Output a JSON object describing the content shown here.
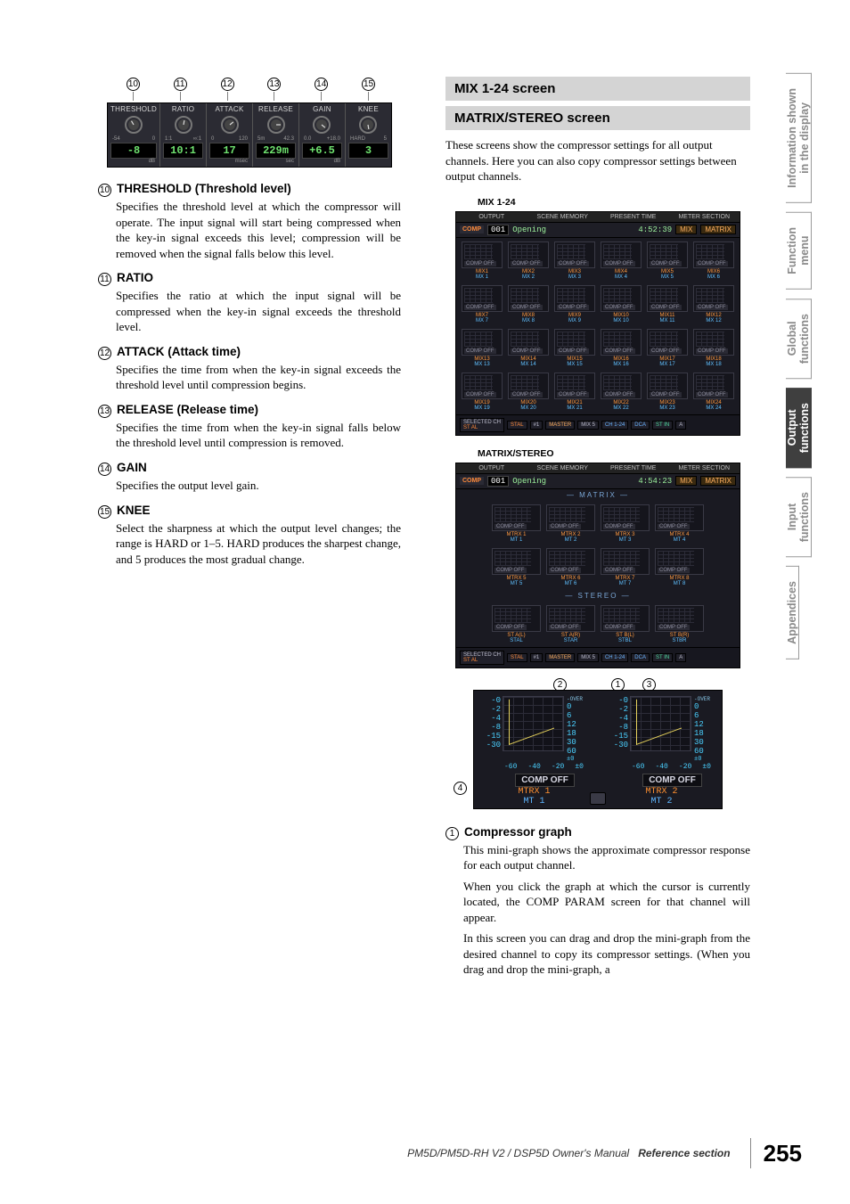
{
  "strip": {
    "cells": [
      {
        "num": "10",
        "label": "THRESHOLD",
        "scale_lo": "-54",
        "scale_hi": "0",
        "value": "-8",
        "unit": "dB"
      },
      {
        "num": "11",
        "label": "RATIO",
        "scale_lo": "1:1",
        "scale_hi": "∞:1",
        "value": "10:1",
        "unit": ""
      },
      {
        "num": "12",
        "label": "ATTACK",
        "scale_lo": "0",
        "scale_hi": "120",
        "value": "17",
        "unit": "msec"
      },
      {
        "num": "13",
        "label": "RELEASE",
        "scale_lo": "5m",
        "scale_hi": "42.3",
        "value": "229m",
        "unit": "sec"
      },
      {
        "num": "14",
        "label": "GAIN",
        "scale_lo": "0.0",
        "scale_hi": "+18.0",
        "value": "+6.5",
        "unit": "dB"
      },
      {
        "num": "15",
        "label": "KNEE",
        "scale_lo": "HARD",
        "scale_hi": "5",
        "value": "3",
        "unit": ""
      }
    ]
  },
  "defs": [
    {
      "num": "J",
      "code": "10",
      "title": "THRESHOLD (Threshold level)",
      "body": [
        "Specifies the threshold level at which the compressor will operate. The input signal will start being compressed when the key-in signal exceeds this level; compression will be removed when the signal falls below this level."
      ]
    },
    {
      "num": "K",
      "code": "11",
      "title": "RATIO",
      "body": [
        "Specifies the ratio at which the input signal will be compressed when the key-in signal exceeds the threshold level."
      ]
    },
    {
      "num": "L",
      "code": "12",
      "title": "ATTACK (Attack time)",
      "body": [
        "Specifies the time from when the key-in signal exceeds the threshold level until compression begins."
      ]
    },
    {
      "num": "M",
      "code": "13",
      "title": "RELEASE (Release time)",
      "body": [
        "Specifies the time from when the key-in signal falls below the threshold level until compression is removed."
      ]
    },
    {
      "num": "N",
      "code": "14",
      "title": "GAIN",
      "body": [
        "Specifies the output level gain."
      ]
    },
    {
      "num": "O",
      "code": "15",
      "title": "KNEE",
      "body": [
        "Select the sharpness at which the output level changes; the range is HARD or 1–5. HARD produces the sharpest change, and 5 produces the most gradual change."
      ]
    }
  ],
  "right": {
    "h1": "MIX 1-24 screen",
    "h2": "MATRIX/STEREO screen",
    "intro": "These screens show the compressor settings for all output channels. Here you can also copy compressor settings between output channels.",
    "fig1_label": "MIX 1-24",
    "fig2_label": "MATRIX/STEREO",
    "shot": {
      "top": {
        "output": "OUTPUT",
        "scene": "SCENE MEMORY",
        "present": "PRESENT TIME",
        "meter": "METER SECTION"
      },
      "row2": {
        "comp": "COMP",
        "num": "001",
        "name": "Opening",
        "time1": "4:52:39",
        "time2": "4:54:23",
        "mix": "MIX",
        "matrix": "MATRIX"
      },
      "grid_btn": "COMP OFF",
      "matrix_title": "MATRIX",
      "stereo_title": "STEREO",
      "bottom": {
        "selected": "SELECTED CH",
        "stal": "ST AL",
        "stal2": "STAL",
        "ph1": "#1",
        "master": "MASTER",
        "mix5": "MIX 5",
        "ch": "CH 1-24",
        "dca": "DCA",
        "stin": "ST IN",
        "a": "A"
      }
    },
    "zoom": {
      "levels": [
        "0",
        "2",
        "4",
        "8",
        "15",
        "30"
      ],
      "gr": {
        "over": "OVER",
        "vals": [
          "0",
          "6",
          "12",
          "18",
          "30",
          "60"
        ],
        "pm": "±0"
      },
      "scale": [
        "-60",
        "-40",
        "-20",
        "±0"
      ],
      "comp_off": "COMP OFF",
      "m1a": "MTRX 1",
      "m1b": "MT 1",
      "m2a": "MTRX 2",
      "m2b": "MT 2",
      "callouts": [
        "2",
        "1",
        "3",
        "4"
      ]
    },
    "defs": [
      {
        "code": "1",
        "title": "Compressor graph",
        "body": [
          "This mini-graph shows the approximate compressor response for each output channel.",
          "When you click the graph at which the cursor is currently located, the COMP PARAM screen for that channel will appear.",
          "In this screen you can drag and drop the mini-graph from the desired channel to copy its compressor settings. (When you drag and drop the mini-graph, a"
        ]
      }
    ]
  },
  "tabs": [
    {
      "label": "Information shown\nin the display",
      "active": false
    },
    {
      "label": "Function\nmenu",
      "active": false
    },
    {
      "label": "Global\nfunctions",
      "active": false
    },
    {
      "label": "Output\nfunctions",
      "active": true
    },
    {
      "label": "Input\nfunctions",
      "active": false
    },
    {
      "label": "Appendices",
      "active": false
    }
  ],
  "footer": {
    "product": "PM5D/PM5D-RH V2 / DSP5D Owner's Manual",
    "section": "Reference section",
    "page": "255"
  }
}
